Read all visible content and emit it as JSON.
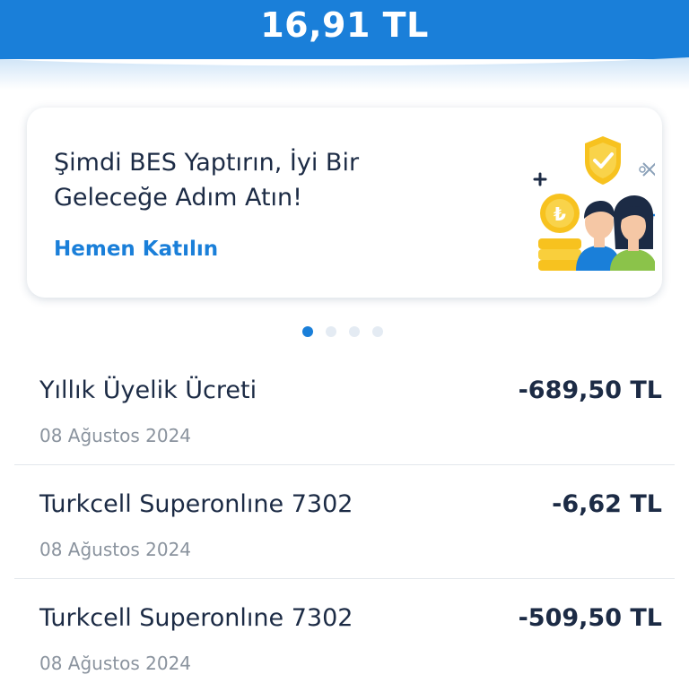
{
  "header": {
    "balance": "16,91 TL",
    "colors": {
      "primary": "#1a7fd9"
    }
  },
  "promo": {
    "title": "Şimdi BES Yaptırın, İyi Bir Geleceğe Adım Atın!",
    "cta": "Hemen Katılın",
    "illustration_icons": [
      "plus-icon",
      "shield-check-icon",
      "close-icon",
      "lira-coin-icon",
      "people-icon"
    ]
  },
  "pager": {
    "count": 4,
    "active_index": 0
  },
  "transactions": [
    {
      "name": "Yıllık Üyelik Ücreti",
      "amount": "-689,50 TL",
      "date": "08 Ağustos 2024"
    },
    {
      "name": "Turkcell Superonlıne 7302",
      "amount": "-6,62 TL",
      "date": "08 Ağustos 2024"
    },
    {
      "name": "Turkcell Superonlıne 7302",
      "amount": "-509,50 TL",
      "date": "08 Ağustos 2024"
    }
  ]
}
